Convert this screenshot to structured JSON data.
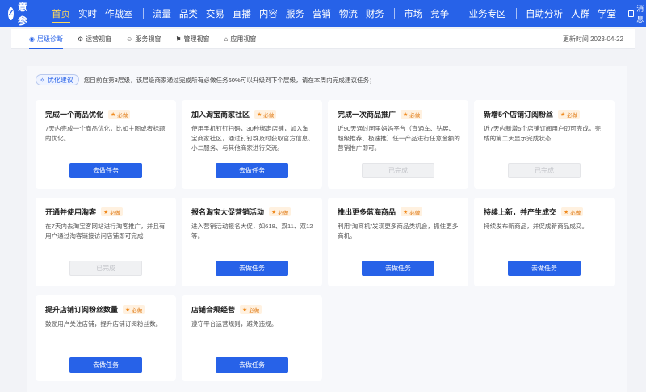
{
  "app": {
    "logo_glyph": "Z",
    "title": "生意参谋"
  },
  "nav": {
    "group1": [
      "首页",
      "实时",
      "作战室"
    ],
    "group2": [
      "流量",
      "品类",
      "交易",
      "直播",
      "内容",
      "服务",
      "营销",
      "物流",
      "财务"
    ],
    "group3": [
      "市场",
      "竞争"
    ],
    "group4": [
      "业务专区"
    ],
    "group5": [
      "自助分析",
      "人群",
      "学堂"
    ],
    "message": "消息"
  },
  "subtabs": [
    "层级诊断",
    "运营视窗",
    "服务视窗",
    "管理视窗",
    "应用视窗"
  ],
  "update_time": "更新时间 2023-04-22",
  "tip": {
    "badge": "优化建议",
    "text": "您目前在第3层级，该层级商家通过完成所有必做任务60%可以升级到下个层级，请在本周内完成建议任务；"
  },
  "required_label": "必做",
  "cards": [
    {
      "title": "完成一个商品优化",
      "desc": "7天内完成一个商品优化，比如主图或者标题的优化。",
      "button": "去做任务",
      "status": "todo"
    },
    {
      "title": "加入淘宝商家社区",
      "desc": "使用手机钉钉扫码，30秒绑定店铺，加入淘宝商家社区，通过钉钉群及时获取官方信息、小二服务、与其他商家进行交流。",
      "button": "去做任务",
      "status": "todo"
    },
    {
      "title": "完成一次商品推广",
      "desc": "近90天通过阿里妈妈平台（直通车、钻展、超级推荐、极速推）任一产品进行任意金额的营销推广即可。",
      "button": "已完成",
      "status": "done"
    },
    {
      "title": "新增5个店铺订阅粉丝",
      "desc": "近7天内新增5个店铺订阅用户即可完成，完成的第二天显示完成状态",
      "button": "已完成",
      "status": "done"
    },
    {
      "title": "开通并使用淘客",
      "desc": "在7天内去淘宝客网站进行淘客推广，并且有用户通过淘客链接访问店铺即可完成",
      "button": "已完成",
      "status": "done"
    },
    {
      "title": "报名淘宝大促营销活动",
      "desc": "进入营销活动报名大促，如618、双11、双12等。",
      "button": "去做任务",
      "status": "todo"
    },
    {
      "title": "推出更多蓝海商品",
      "desc": "利用“淘商机”发现更多商品类机会，抓住更多商机。",
      "button": "去做任务",
      "status": "todo"
    },
    {
      "title": "持续上新，并产生成交",
      "desc": "持续发布新商品，并促成新商品成交。",
      "button": "去做任务",
      "status": "todo"
    },
    {
      "title": "提升店铺订阅粉丝数量",
      "desc": "鼓励用户关注店铺，提升店铺订阅粉丝数。",
      "button": "去做任务",
      "status": "todo"
    },
    {
      "title": "店铺合规经营",
      "desc": "遵守平台运营规则，避免违规。",
      "button": "去做任务",
      "status": "todo"
    }
  ]
}
